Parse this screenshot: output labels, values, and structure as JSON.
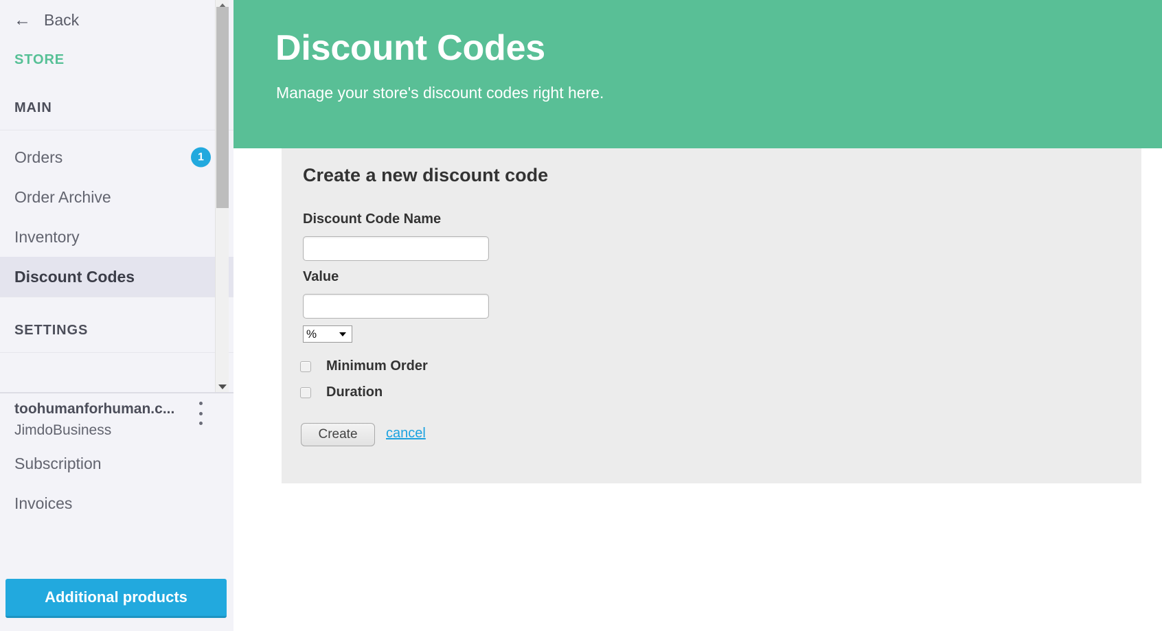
{
  "sidebar": {
    "back_label": "Back",
    "back_icon": "arrow-left-icon",
    "sections": {
      "store": "STORE",
      "main": "MAIN",
      "settings": "SETTINGS"
    },
    "nav_items": [
      {
        "label": "Orders",
        "badge": "1",
        "active": false
      },
      {
        "label": "Order Archive",
        "badge": "",
        "active": false
      },
      {
        "label": "Inventory",
        "badge": "",
        "active": false
      },
      {
        "label": "Discount Codes",
        "badge": "",
        "active": true
      }
    ],
    "account": {
      "name": "toohumanforhuman.c...",
      "plan": "JimdoBusiness",
      "menu_icon": "kebab-menu-icon"
    },
    "settings_items": [
      {
        "label": "Subscription"
      },
      {
        "label": "Invoices"
      }
    ],
    "additional_products_label": "Additional products",
    "scrollbar": {
      "up_icon": "triangle-up-icon",
      "down_icon": "triangle-down-icon"
    },
    "colors": {
      "background": "#f3f3f8",
      "active_item": "#e4e4ee",
      "store_accent": "#56c096",
      "badge": "#22a9de",
      "cta": "#22a9de"
    }
  },
  "header": {
    "title": "Discount Codes",
    "subtitle": "Manage your store's discount codes right here.",
    "background": "#59bf96"
  },
  "form": {
    "panel_title": "Create a new discount code",
    "fields": {
      "name_label": "Discount Code Name",
      "name_value": "",
      "name_placeholder": "",
      "value_label": "Value",
      "value_value": "",
      "value_placeholder": ""
    },
    "unit_select": {
      "selected": "%",
      "options": [
        "%"
      ],
      "caret_icon": "chevron-down-icon"
    },
    "checkboxes": [
      {
        "label": "Minimum Order",
        "checked": false
      },
      {
        "label": "Duration",
        "checked": false
      }
    ],
    "create_label": "Create",
    "cancel_label": "cancel",
    "panel_background": "#ececec",
    "link_color": "#1ba2e0"
  }
}
